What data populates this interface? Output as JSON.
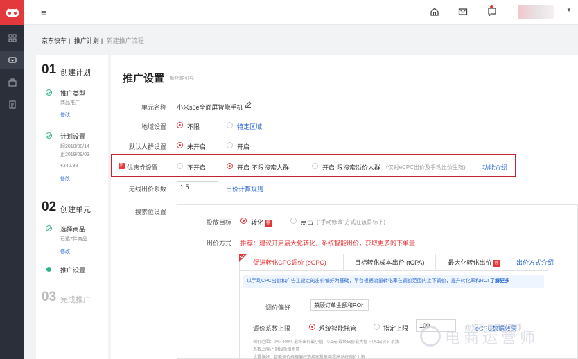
{
  "breadcrumb": [
    "京东快车",
    "推广计划",
    "新建推广流程"
  ],
  "steps": [
    {
      "num": "01",
      "title": "创建计划"
    },
    {
      "num": "02",
      "title": "创建单元"
    },
    {
      "num": "03",
      "title": "完成推广"
    }
  ],
  "step1_subs": [
    {
      "label": "推广类型",
      "lines": [
        "商品推广"
      ],
      "link": "修改"
    },
    {
      "label": "计划设置",
      "lines": [
        "起2018/08/14",
        "止2019/09/03",
        "¥340.98"
      ],
      "link": "修改"
    }
  ],
  "step2_subs": [
    {
      "label": "选择商品",
      "lines": [
        "已选7件商品"
      ],
      "link": "修改"
    },
    {
      "label": "推广设置"
    }
  ],
  "panel": {
    "title": "推广设置",
    "subtitle": "新功能引导",
    "unit_name_label": "单元名称",
    "unit_name_value": "小米s8e全面屏智能手机",
    "region_label": "地域设置",
    "region_opt1": "不限",
    "region_opt2": "特定区域",
    "crowd_label": "默认人群设置",
    "crowd_opt1": "未开启",
    "crowd_opt2": "开启",
    "coupon_label": "优惠券设置",
    "coupon_opt1": "不开启",
    "coupon_opt2": "开启-不限搜索人群",
    "coupon_opt3": "开启-限搜索溢价人群",
    "coupon_hint": "(仅对eCPC出价及手动出价生效)",
    "coupon_link": "功能介绍",
    "coef_label": "无线出价系数",
    "coef_value": "1.5",
    "coef_link": "出价计算规则",
    "search_label": "搜索位设置",
    "target_label": "投放目标",
    "target_opt1": "转化",
    "target_tag": "荐",
    "target_opt2": "点击",
    "target_hint": "(\"手动修改\"方式在该目标下)",
    "bid_label": "出价方式",
    "bid_recommend": "推荐：建议开启最大化转化，系统智能出价，获取更多的下单量",
    "tab1": "促进转化CPC调价 (eCPC)",
    "tab2": "目标转化成本出价 (tCPA)",
    "tab3": "最大化转化出价",
    "tab3_tag": "荐",
    "tab_link": "出价方式介绍",
    "note": "以手动CPC出价和广告主设定的出价偏好为基础，平台根据流量转化率在调价范围内上下调价，提升转化率和ROI",
    "note_link": "了解更多",
    "pref_label": "调价偏好",
    "pref_value": "兼顾订单金额和ROI",
    "upper_label": "调价系数上限",
    "upper_opt1": "系统智能托管",
    "upper_opt2": "指定上限",
    "upper_value": "100",
    "upper_link": "eCPC数据效果",
    "fine1": "调价范围：0%~400%        最终出价最小值：0.1元        最终出价最大值 = PC出价 x 系数",
    "fine2": "系数上限) * 时段折扣系数",
    "fine3": "设置偏好：智能调价根据偏好选择在投放中提高系统调价上限"
  },
  "watermark": "电商运营师",
  "watermark_small": "@知乎 电商运营师"
}
